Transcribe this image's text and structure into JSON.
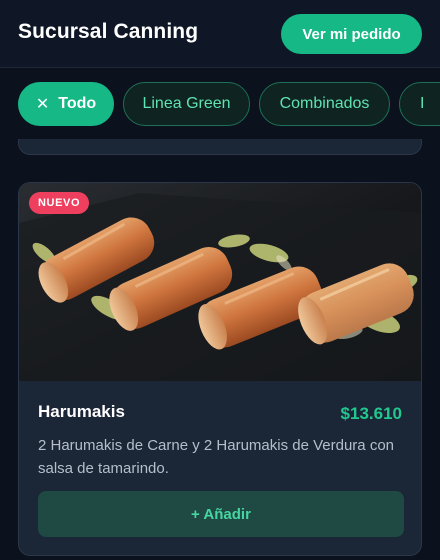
{
  "header": {
    "title": "Sucursal Canning",
    "order_button": "Ver mi pedido"
  },
  "filters": {
    "items": [
      {
        "label": "Todo",
        "active": true,
        "icon": "close-icon"
      },
      {
        "label": "Linea Green",
        "active": false
      },
      {
        "label": "Combinados",
        "active": false
      },
      {
        "label": "I",
        "active": false
      }
    ]
  },
  "previous_card": {
    "text": "..."
  },
  "product": {
    "badge": "NUEVO",
    "name": "Harumakis",
    "price": "$13.610",
    "description": "2 Harumakis de Carne y 2 Harumakis de Verdura con salsa de tamarindo.",
    "add_label": "+ Añadir",
    "image": "harumaki-spring-rolls-photo"
  },
  "colors": {
    "accent": "#16b886",
    "price": "#21c98f",
    "badge": "#ef3f5f",
    "background": "#0b111d",
    "card": "#1b2636"
  }
}
